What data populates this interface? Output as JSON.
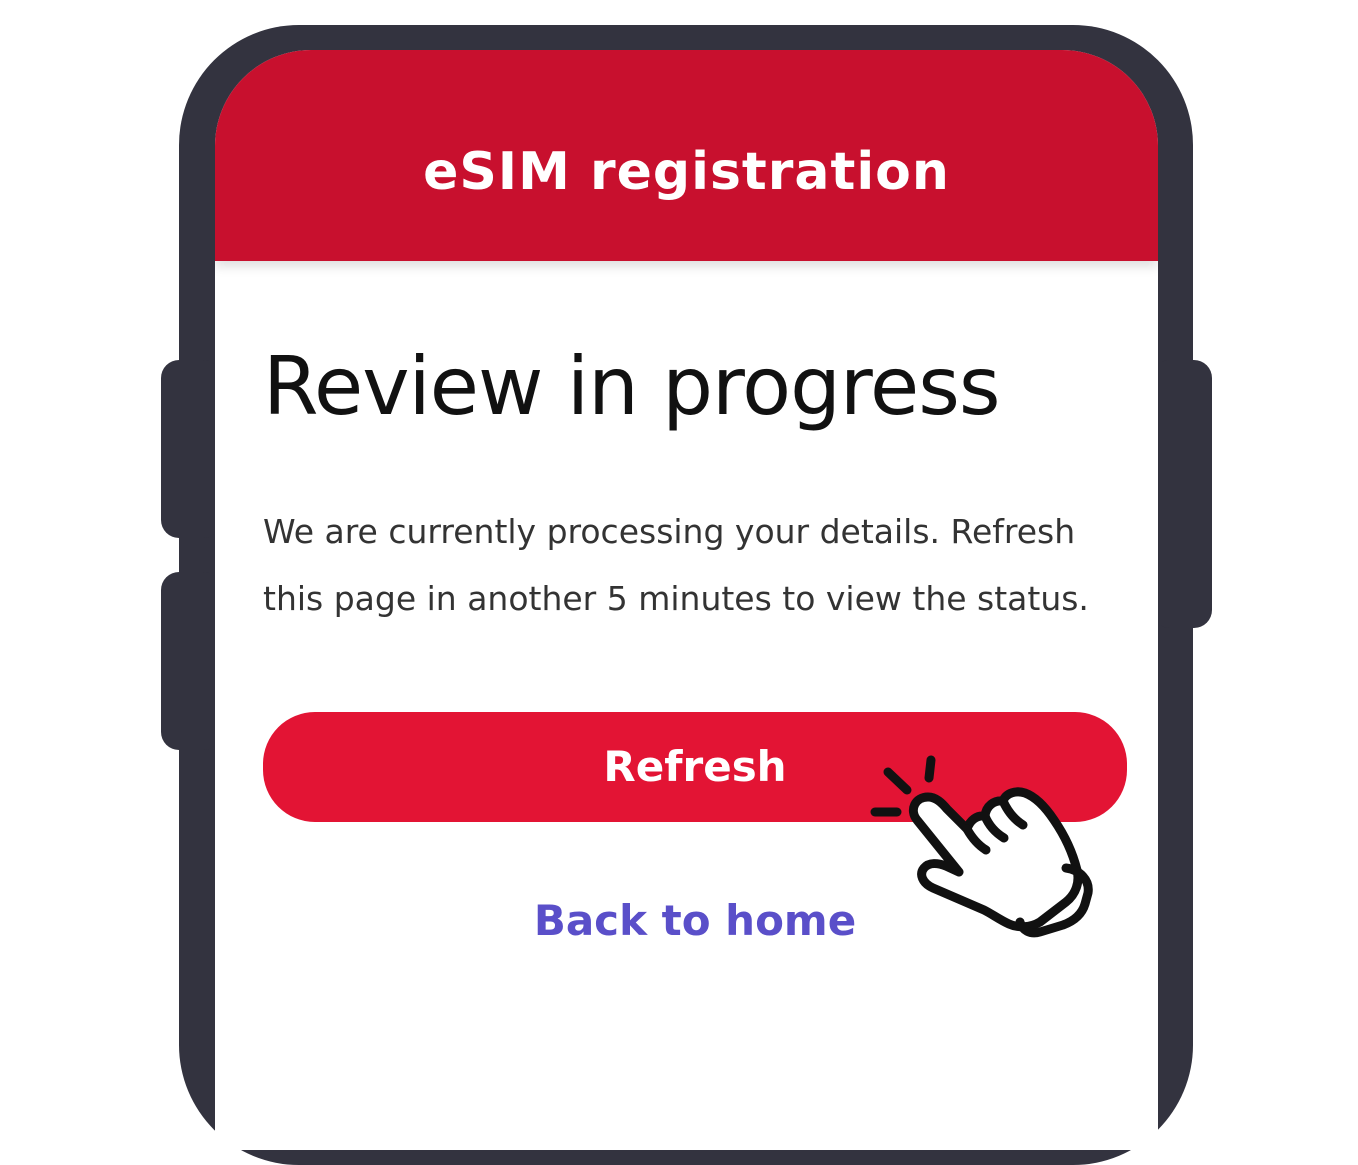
{
  "header": {
    "title": "eSIM registration",
    "background_color": "#c8102e"
  },
  "main": {
    "heading": "Review in progress",
    "description": "We are currently processing your details. Refresh this page in another 5 minutes to view the status.",
    "refresh_button_label": "Refresh",
    "back_link_label": "Back to home"
  },
  "colors": {
    "frame": "#33333f",
    "button": "#e31434",
    "link": "#5a4fc9"
  },
  "icons": {
    "hand": "hand-pointer-click-icon"
  }
}
